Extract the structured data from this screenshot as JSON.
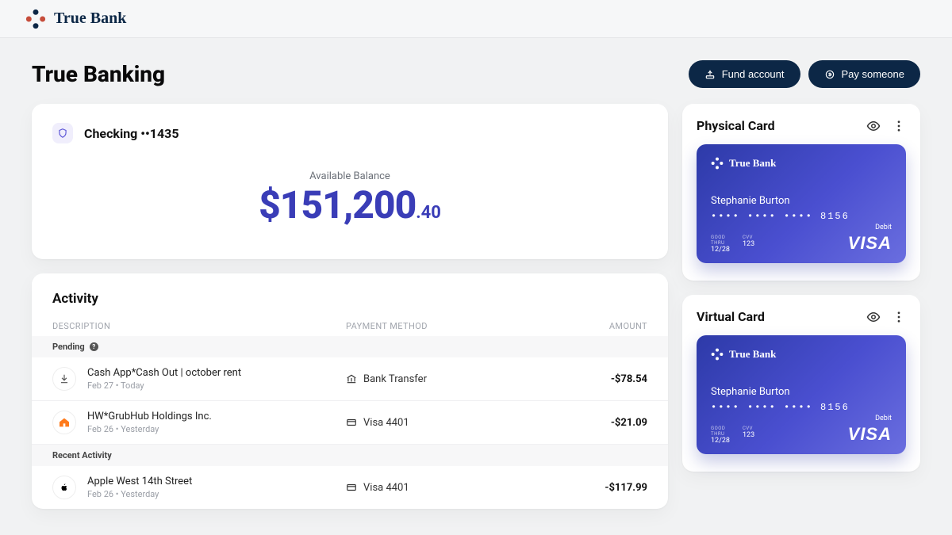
{
  "brand": {
    "name": "True Bank"
  },
  "header": {
    "title": "True Banking",
    "fund_label": "Fund account",
    "pay_label": "Pay someone"
  },
  "account": {
    "name": "Checking ••1435",
    "balance_label": "Available Balance",
    "balance_main": "$151,200",
    "balance_cents": ".40"
  },
  "activity": {
    "title": "Activity",
    "cols": {
      "desc": "DESCRIPTION",
      "method": "PAYMENT METHOD",
      "amount": "AMOUNT"
    },
    "groups": {
      "pending": "Pending",
      "recent": "Recent Activity"
    },
    "pending": [
      {
        "icon": "cash-out",
        "title": "Cash App*Cash Out | october rent",
        "sub": "Feb 27 • Today",
        "method_icon": "bank",
        "method": "Bank Transfer",
        "amount": "-$78.54"
      },
      {
        "icon": "grubhub",
        "title": "HW*GrubHub Holdings Inc.",
        "sub": "Feb 26 • Yesterday",
        "method_icon": "card",
        "method": "Visa 4401",
        "amount": "-$21.09"
      }
    ],
    "recent": [
      {
        "icon": "apple",
        "title": "Apple West 14th Street",
        "sub": "Feb 26 • Yesterday",
        "method_icon": "card",
        "method": "Visa 4401",
        "amount": "-$117.99"
      }
    ]
  },
  "cards": {
    "physical": {
      "title": "Physical Card",
      "brand": "True Bank",
      "holder": "Stephanie Burton",
      "number": "•••• •••• •••• 8156",
      "good_thru_label": "GOOD\nTHRU",
      "good_thru": "12/28",
      "cvv_label": "CVV",
      "cvv": "123",
      "type": "Debit",
      "network": "VISA"
    },
    "virtual": {
      "title": "Virtual Card",
      "brand": "True Bank",
      "holder": "Stephanie Burton",
      "number": "•••• •••• •••• 8156",
      "good_thru_label": "GOOD\nTHRU",
      "good_thru": "12/28",
      "cvv_label": "CVV",
      "cvv": "123",
      "type": "Debit",
      "network": "VISA"
    }
  }
}
